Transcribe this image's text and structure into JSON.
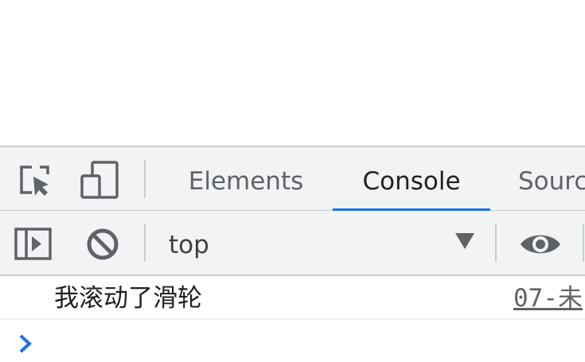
{
  "devtools": {
    "tabs": [
      {
        "label": "Elements",
        "active": false
      },
      {
        "label": "Console",
        "active": true
      },
      {
        "label": "Sourc",
        "active": false
      }
    ],
    "toolbar_icons": {
      "inspect": "inspect-element-icon",
      "device": "device-toolbar-icon",
      "sidebar": "show-console-sidebar-icon",
      "clear": "clear-console-icon",
      "live_expression": "eye-icon"
    },
    "context_selector": {
      "value": "top"
    },
    "console": {
      "messages": [
        {
          "text": "我滚动了滑轮",
          "source": "07-未"
        }
      ],
      "prompt_symbol": "chevron-right-icon"
    },
    "colors": {
      "accent": "#1a73e8",
      "panel_bg": "#f1f3f4",
      "border": "#cacdd1",
      "icon": "#5f6368"
    }
  }
}
